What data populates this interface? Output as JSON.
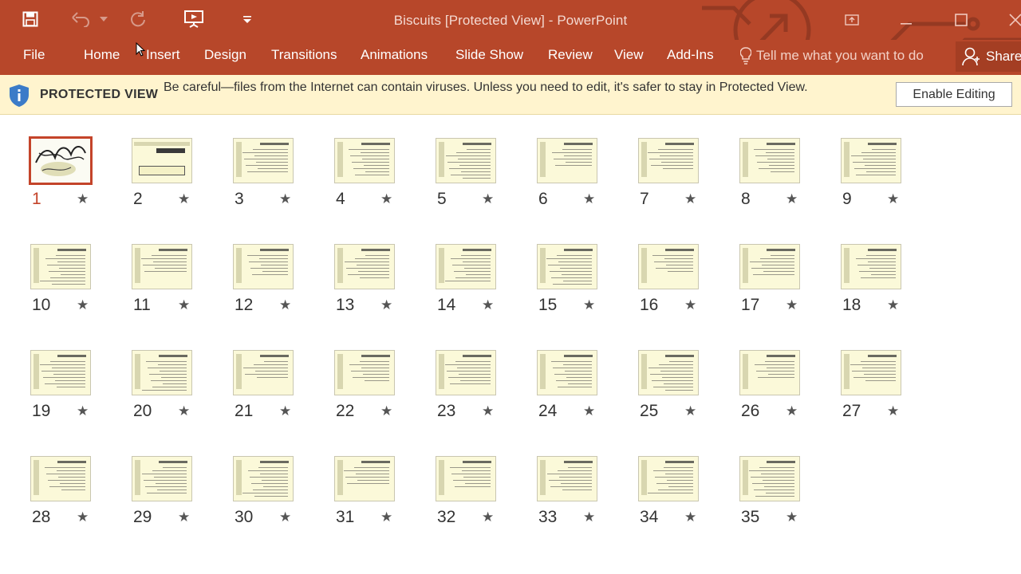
{
  "window": {
    "title": "Biscuits [Protected View] - PowerPoint"
  },
  "tabs": [
    "File",
    "Home",
    "Insert",
    "Design",
    "Transitions",
    "Animations",
    "Slide Show",
    "Review",
    "View",
    "Add-Ins"
  ],
  "tell_me": "Tell me what you want to do",
  "share": "Share",
  "protected_view": {
    "label": "PROTECTED VIEW",
    "message": "Be careful—files from the Internet can contain viruses. Unless you need to edit, it's safer to stay in Protected View.",
    "enable_button": "Enable Editing"
  },
  "slides": {
    "selected": "1",
    "numbers": [
      "1",
      "2",
      "3",
      "4",
      "5",
      "6",
      "7",
      "8",
      "9",
      "10",
      "11",
      "12",
      "13",
      "14",
      "15",
      "16",
      "17",
      "18",
      "19",
      "20",
      "21",
      "22",
      "23",
      "24",
      "25",
      "26",
      "27",
      "28",
      "29",
      "30",
      "31",
      "32",
      "33",
      "34",
      "35"
    ],
    "transition_marker": "★"
  },
  "colors": {
    "accent": "#b7472a",
    "message_bar": "#fff4ce",
    "selection": "#c4442a",
    "slide_bg": "#fbf9d9"
  },
  "icons": [
    "save-icon",
    "undo-icon",
    "redo-icon",
    "present-icon",
    "customize-qat-icon",
    "ribbon-display-icon",
    "minimize-icon",
    "maximize-icon",
    "close-icon",
    "lightbulb-icon",
    "person-icon",
    "shield-icon",
    "star-icon"
  ]
}
